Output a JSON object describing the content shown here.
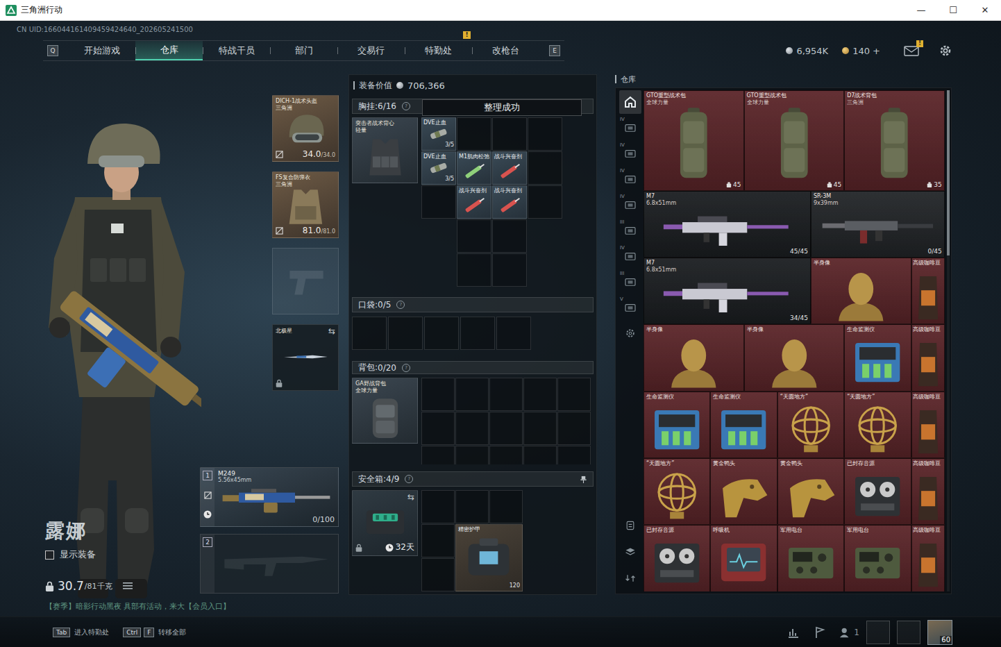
{
  "window": {
    "title": "三角洲行动",
    "controls": [
      "—",
      "☐",
      "✕"
    ]
  },
  "uid": "CN UID:166044161409459424640_202605241500",
  "nav": {
    "keys": [
      "Q",
      "E"
    ],
    "badge": "!",
    "tabs": [
      {
        "label": "开始游戏",
        "selected": false,
        "badge": false
      },
      {
        "label": "仓库",
        "selected": true,
        "badge": false
      },
      {
        "label": "特战干员",
        "selected": false,
        "badge": false
      },
      {
        "label": "部门",
        "selected": false,
        "badge": false
      },
      {
        "label": "交易行",
        "selected": false,
        "badge": false
      },
      {
        "label": "特勤处",
        "selected": false,
        "badge": true
      },
      {
        "label": "改枪台",
        "selected": false,
        "badge": false
      }
    ]
  },
  "currency": [
    {
      "kind": "coin",
      "value": "6,954K"
    },
    {
      "kind": "ticket",
      "value": "140 +"
    }
  ],
  "mail": {
    "badge": "!"
  },
  "operator": {
    "name": "露娜",
    "show_gear": {
      "label": "显示装备",
      "checked": false
    },
    "weight": "30.7",
    "capacity": "/81千克",
    "event": "【赛季】暗影行动黑夜 具部有活动，来大【会员入口】"
  },
  "gear": {
    "helmet": {
      "name": "DICH-1战术头盔",
      "sub": "三角洲",
      "durability": "34.0",
      "max": "/34.0"
    },
    "armor": {
      "name": "FS复合防弹衣",
      "sub": "三角洲",
      "durability": "81.0",
      "max": "/81.0"
    },
    "pistol": {
      "filled": false
    },
    "melee": {
      "name": "北极星",
      "swap": "⇆",
      "locked": true
    }
  },
  "weapons": [
    {
      "index": "1",
      "name": "M249",
      "caliber": "5.56x45mm",
      "ammo": "0/100",
      "filled": true
    },
    {
      "index": "2",
      "filled": false
    }
  ],
  "loadout": {
    "value_label": "装备价值",
    "value": "706,366",
    "help": "?",
    "toast": "整理成功",
    "chest": {
      "label": "胸挂: ",
      "count": "6/16",
      "rig": {
        "name": "突击者战术背心",
        "sub": "轻量"
      },
      "slots": [
        {
          "filled": true,
          "kind": "tourniquet",
          "name": "DVE止血",
          "count": "3/5"
        },
        {
          "filled": false
        },
        {
          "filled": false
        },
        {
          "filled": false
        },
        {
          "filled": true,
          "kind": "tourniquet",
          "name": "DVE止血",
          "count": "3/5"
        },
        {
          "filled": true,
          "kind": "muscle",
          "name": "M1肌肉松弛"
        },
        {
          "filled": true,
          "kind": "stim",
          "name": "战斗兴奋剂"
        },
        {
          "filled": false
        },
        {
          "filled": false
        },
        {
          "filled": true,
          "kind": "stim",
          "name": "战斗兴奋剂"
        },
        {
          "filled": true,
          "kind": "stim",
          "name": "战斗兴奋剂"
        },
        {
          "filled": false
        }
      ]
    },
    "pockets": {
      "label": "口袋: ",
      "count": "0/5",
      "slots": [
        {
          "filled": false
        },
        {
          "filled": false
        },
        {
          "filled": false
        },
        {
          "filled": false
        },
        {
          "filled": false
        }
      ]
    },
    "backpack": {
      "label": "背包: ",
      "count": "0/20",
      "bag": {
        "name": "GA野战背包",
        "sub": "全球力量"
      }
    },
    "safe": {
      "label": "安全箱: ",
      "count": "4/9",
      "swap": "⇆",
      "timer": "32天",
      "item": {
        "name": "精密护甲",
        "count": "120"
      }
    }
  },
  "warehouse": {
    "title": "仓库",
    "scrollbar": {
      "level": 0.33
    },
    "tabs": [
      {
        "kind": "home",
        "selected": true
      },
      {
        "kind": "category",
        "tier": "IV",
        "selected": false
      },
      {
        "kind": "category",
        "tier": "IV",
        "selected": false
      },
      {
        "kind": "category",
        "tier": "IV",
        "selected": false
      },
      {
        "kind": "category",
        "tier": "IV",
        "selected": false
      },
      {
        "kind": "category",
        "tier": "III",
        "selected": false
      },
      {
        "kind": "category",
        "tier": "IV",
        "selected": false
      },
      {
        "kind": "category",
        "tier": "III",
        "selected": false
      },
      {
        "kind": "category",
        "tier": "V",
        "selected": false
      },
      {
        "kind": "settings",
        "selected": false
      }
    ],
    "tools": [
      "sort",
      "layers",
      "transfer"
    ],
    "items": [
      {
        "kind": "bag",
        "name": "GTO重型战术包",
        "sub": "全球力量",
        "count": "45",
        "color": "#5b2529"
      },
      {
        "kind": "bag",
        "name": "GTO重型战术包",
        "sub": "全球力量",
        "count": "45",
        "color": "#5b2529"
      },
      {
        "kind": "bag",
        "name": "D7战术背包",
        "sub": "三角洲",
        "count": "35",
        "color": "#5b2529"
      },
      {
        "kind": "rifle",
        "name": "M7",
        "sub": "6.8x51mm",
        "count": "45/45",
        "color": "#1b1e21"
      },
      {
        "kind": "smg",
        "name": "SR-3M",
        "sub": "9x39mm",
        "count": "0/45",
        "color": "#222528"
      },
      {
        "kind": "rifle",
        "name": "M7",
        "sub": "6.8x51mm",
        "count": "34/45",
        "color": "#1b1e21"
      },
      {
        "kind": "bust",
        "name": "半身像",
        "color": "#5b2529"
      },
      {
        "kind": "coffee",
        "name": "高级咖啡豆",
        "color": "#5b2529"
      },
      {
        "kind": "bust",
        "name": "半身像",
        "color": "#5b2529"
      },
      {
        "kind": "bust",
        "name": "半身像",
        "color": "#5b2529"
      },
      {
        "kind": "monitor",
        "name": "生命监测仪",
        "color": "#5b2529"
      },
      {
        "kind": "coffee",
        "name": "高级咖啡豆",
        "color": "#5b2529"
      },
      {
        "kind": "monitor",
        "name": "生命监测仪",
        "color": "#5b2529"
      },
      {
        "kind": "monitor",
        "name": "生命监测仪",
        "color": "#5b2529"
      },
      {
        "kind": "sphere",
        "name": "“天圆地方”",
        "color": "#5b2529"
      },
      {
        "kind": "sphere",
        "name": "“天圆地方”",
        "color": "#5b2529"
      },
      {
        "kind": "coffee",
        "name": "高级咖啡豆",
        "color": "#5b2529"
      },
      {
        "kind": "sphere",
        "name": "“天圆地方”",
        "color": "#5b2529"
      },
      {
        "kind": "head",
        "name": "黄金鸭头",
        "color": "#5b2529"
      },
      {
        "kind": "head",
        "name": "黄金鸭头",
        "color": "#5b2529"
      },
      {
        "kind": "recorder",
        "name": "已封存音源",
        "color": "#5b2529"
      },
      {
        "kind": "coffee",
        "name": "高级咖啡豆",
        "color": "#5b2529"
      },
      {
        "kind": "recorder",
        "name": "已封存音源",
        "color": "#5b2529"
      },
      {
        "kind": "ventilator",
        "name": "呼吸机",
        "color": "#5b2529"
      },
      {
        "kind": "radio",
        "name": "军用电台",
        "color": "#5b2529"
      },
      {
        "kind": "radio",
        "name": "军用电台",
        "color": "#5b2529"
      },
      {
        "kind": "coffee",
        "name": "高级咖啡豆",
        "color": "#5b2529"
      }
    ]
  },
  "footer": {
    "hints": [
      {
        "keys": [
          "Tab"
        ],
        "label": "进入特勤处"
      },
      {
        "keys": [
          "Ctrl",
          "F"
        ],
        "label": "转移全部"
      }
    ],
    "friends": "1",
    "level": "60"
  }
}
